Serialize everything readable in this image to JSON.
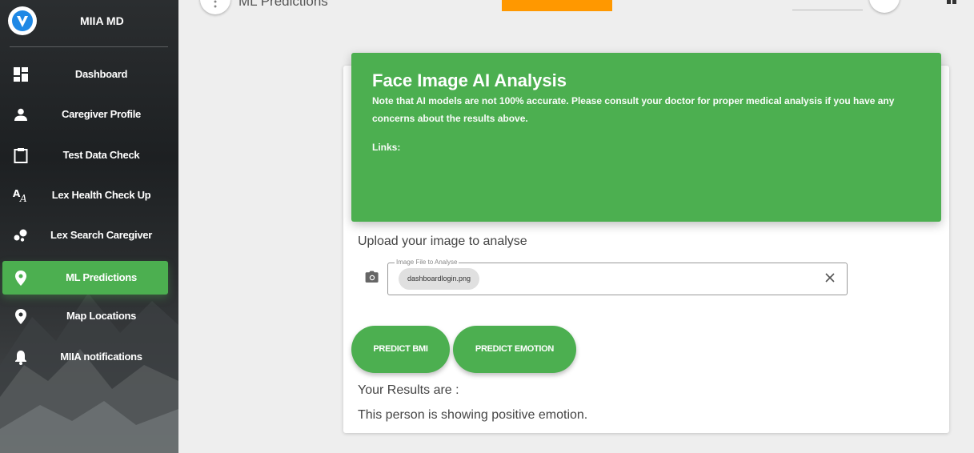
{
  "app": {
    "name": "MIIA MD"
  },
  "sidebar": {
    "items": [
      {
        "label": "Dashboard",
        "icon": "dashboard-icon",
        "active": false
      },
      {
        "label": "Caregiver Profile",
        "icon": "person-icon",
        "active": false
      },
      {
        "label": "Test Data Check",
        "icon": "clipboard-icon",
        "active": false
      },
      {
        "label": "Lex Health Check Up",
        "icon": "text-spellcheck-icon",
        "active": false
      },
      {
        "label": "Lex Search Caregiver",
        "icon": "bubbles-icon",
        "active": false
      },
      {
        "label": "ML Predictions",
        "icon": "location-pin-icon",
        "active": true
      },
      {
        "label": "Map Locations",
        "icon": "location-pin-icon",
        "active": false
      },
      {
        "label": "MIIA notifications",
        "icon": "bell-icon",
        "active": false
      }
    ]
  },
  "topbar": {
    "title": "ML Predictions"
  },
  "colors": {
    "accent": "#4caf50",
    "orange": "#ff9800"
  },
  "card": {
    "title": "Face Image AI Analysis",
    "note": "Note that AI models are not 100% accurate. Please consult your doctor for proper medical analysis if you have any concerns about the results above.",
    "links_label": "Links:"
  },
  "upload": {
    "label": "Upload your image to analyse",
    "field_label": "Image File to Analyse",
    "file_name": "dashboardlogin.png"
  },
  "buttons": {
    "predict_bmi": "PREDICT BMI",
    "predict_emotion": "PREDICT EMOTION"
  },
  "results": {
    "label": "Your Results are :",
    "text": "This person is showing positive emotion."
  }
}
